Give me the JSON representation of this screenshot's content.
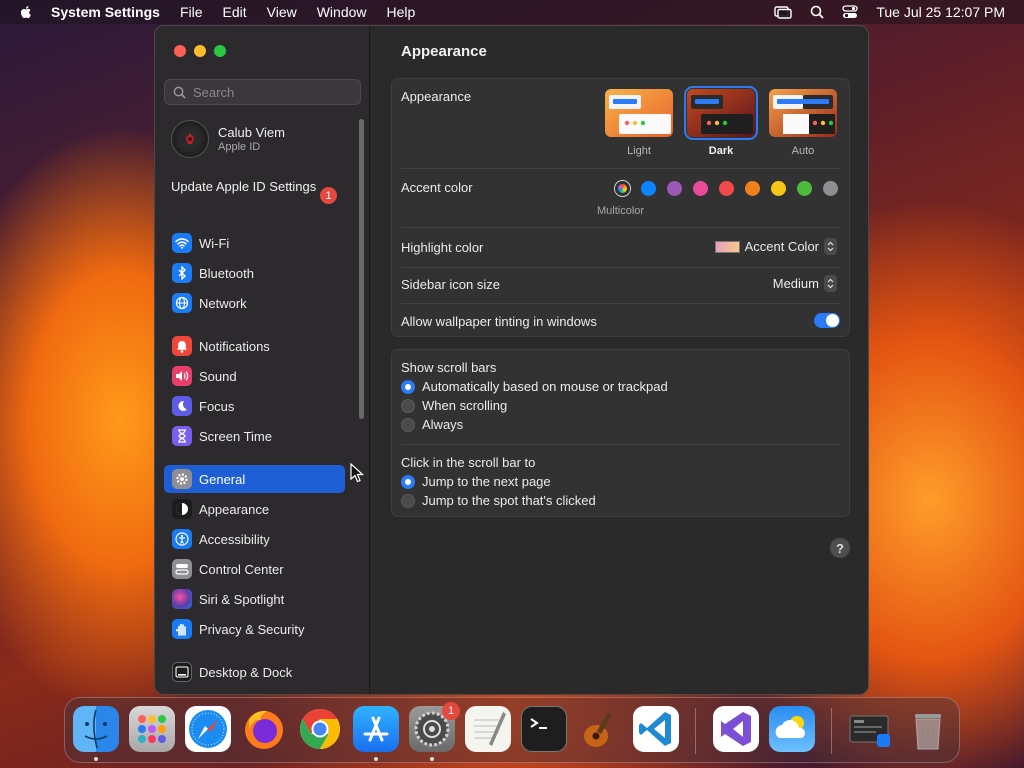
{
  "menubar": {
    "app_name": "System Settings",
    "items": [
      "File",
      "Edit",
      "View",
      "Window",
      "Help"
    ],
    "clock": "Tue Jul 25  12:07 PM"
  },
  "sidebar": {
    "search_placeholder": "Search",
    "account": {
      "name": "Calub Viem",
      "subtitle": "Apple ID"
    },
    "update": {
      "label": "Update Apple ID Settings",
      "badge": "1"
    },
    "items": [
      {
        "label": "Wi-Fi",
        "icon": "wifi-icon",
        "color": "#1a7cf5"
      },
      {
        "label": "Bluetooth",
        "icon": "bluetooth-icon",
        "color": "#1a7cf5"
      },
      {
        "label": "Network",
        "icon": "globe-icon",
        "color": "#1a7cf5"
      },
      {
        "label": "Notifications",
        "icon": "bell-icon",
        "color": "#f0463c"
      },
      {
        "label": "Sound",
        "icon": "speaker-icon",
        "color": "#e83e6a"
      },
      {
        "label": "Focus",
        "icon": "moon-icon",
        "color": "#5e5ce6"
      },
      {
        "label": "Screen Time",
        "icon": "hourglass-icon",
        "color": "#7a5cf0"
      },
      {
        "label": "General",
        "icon": "gear-icon",
        "color": "#8e8e93",
        "selected": true
      },
      {
        "label": "Appearance",
        "icon": "appearance-icon",
        "color": "#1c1c1e"
      },
      {
        "label": "Accessibility",
        "icon": "accessibility-icon",
        "color": "#1a7cf5"
      },
      {
        "label": "Control Center",
        "icon": "control-center-icon",
        "color": "#8e8e93"
      },
      {
        "label": "Siri & Spotlight",
        "icon": "siri-icon",
        "color": "#5b3ea8"
      },
      {
        "label": "Privacy & Security",
        "icon": "hand-icon",
        "color": "#1a7cf5"
      },
      {
        "label": "Desktop & Dock",
        "icon": "dock-icon",
        "color": "#1c1c1e"
      }
    ]
  },
  "content": {
    "title": "Appearance",
    "appearance": {
      "label": "Appearance",
      "options": [
        {
          "label": "Light",
          "selected": false
        },
        {
          "label": "Dark",
          "selected": true
        },
        {
          "label": "Auto",
          "selected": false
        }
      ]
    },
    "accent": {
      "label": "Accent color",
      "multicolor_label": "Multicolor",
      "colors": [
        "#0a84ff",
        "#9b59b6",
        "#e94b9b",
        "#f2494a",
        "#f0801c",
        "#f5c518",
        "#4cbb3c",
        "#8e8e93"
      ]
    },
    "highlight": {
      "label": "Highlight color",
      "value": "Accent Color"
    },
    "sidebar_icon_size": {
      "label": "Sidebar icon size",
      "value": "Medium"
    },
    "wallpaper_tinting": {
      "label": "Allow wallpaper tinting in windows",
      "enabled": true
    },
    "scroll_bars": {
      "label": "Show scroll bars",
      "options": [
        {
          "label": "Automatically based on mouse or trackpad",
          "selected": true
        },
        {
          "label": "When scrolling",
          "selected": false
        },
        {
          "label": "Always",
          "selected": false
        }
      ]
    },
    "click_scroll": {
      "label": "Click in the scroll bar to",
      "options": [
        {
          "label": "Jump to the next page",
          "selected": true
        },
        {
          "label": "Jump to the spot that's clicked",
          "selected": false
        }
      ]
    },
    "help": "?"
  },
  "dock": {
    "apps": [
      "Finder",
      "Launchpad",
      "Safari",
      "Firefox",
      "Chrome",
      "App Store",
      "System Settings",
      "TextEdit",
      "Terminal",
      "GarageBand",
      "Visual Studio Code",
      "Visual Studio",
      "Weather",
      "Downloads",
      "Trash"
    ],
    "settings_badge": "1"
  }
}
